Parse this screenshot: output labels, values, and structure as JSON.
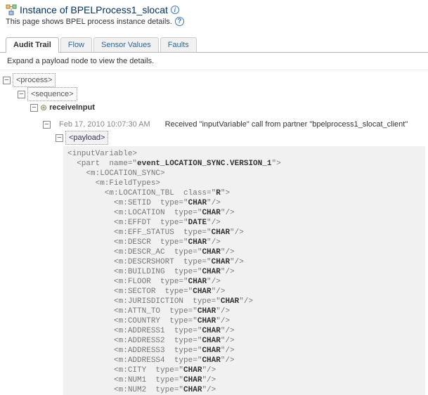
{
  "header": {
    "title": "Instance of BPELProcess1_slocat",
    "subtitle": "This page shows BPEL process instance details."
  },
  "tabs": [
    {
      "label": "Audit Trail",
      "active": true
    },
    {
      "label": "Flow",
      "active": false
    },
    {
      "label": "Sensor Values",
      "active": false
    },
    {
      "label": "Faults",
      "active": false
    }
  ],
  "hint": "Expand a payload node to view the details.",
  "tree": {
    "process": "<process>",
    "sequence": "<sequence>",
    "receive": "receiveInput",
    "timestamp": "Feb 17, 2010 10:07:30 AM",
    "message": "Received \"inputVariable\" call from partner \"bpelprocess1_slocat_client\"",
    "payload_label": "<payload>"
  },
  "payload": {
    "root": "inputVariable",
    "part_name": "event_LOCATION_SYNC.VERSION_1",
    "loc_sync": "m:LOCATION_SYNC",
    "field_types": "m:FieldTypes",
    "tbl_tag": "m:LOCATION_TBL",
    "tbl_class": "R",
    "fields": [
      {
        "tag": "m:SETID",
        "type": "CHAR"
      },
      {
        "tag": "m:LOCATION",
        "type": "CHAR"
      },
      {
        "tag": "m:EFFDT",
        "type": "DATE"
      },
      {
        "tag": "m:EFF_STATUS",
        "type": "CHAR"
      },
      {
        "tag": "m:DESCR",
        "type": "CHAR"
      },
      {
        "tag": "m:DESCR_AC",
        "type": "CHAR"
      },
      {
        "tag": "m:DESCRSHORT",
        "type": "CHAR"
      },
      {
        "tag": "m:BUILDING",
        "type": "CHAR"
      },
      {
        "tag": "m:FLOOR",
        "type": "CHAR"
      },
      {
        "tag": "m:SECTOR",
        "type": "CHAR"
      },
      {
        "tag": "m:JURISDICTION",
        "type": "CHAR"
      },
      {
        "tag": "m:ATTN_TO",
        "type": "CHAR"
      },
      {
        "tag": "m:COUNTRY",
        "type": "CHAR"
      },
      {
        "tag": "m:ADDRESS1",
        "type": "CHAR"
      },
      {
        "tag": "m:ADDRESS2",
        "type": "CHAR"
      },
      {
        "tag": "m:ADDRESS3",
        "type": "CHAR"
      },
      {
        "tag": "m:ADDRESS4",
        "type": "CHAR"
      },
      {
        "tag": "m:CITY",
        "type": "CHAR"
      },
      {
        "tag": "m:NUM1",
        "type": "CHAR"
      },
      {
        "tag": "m:NUM2",
        "type": "CHAR"
      }
    ]
  }
}
